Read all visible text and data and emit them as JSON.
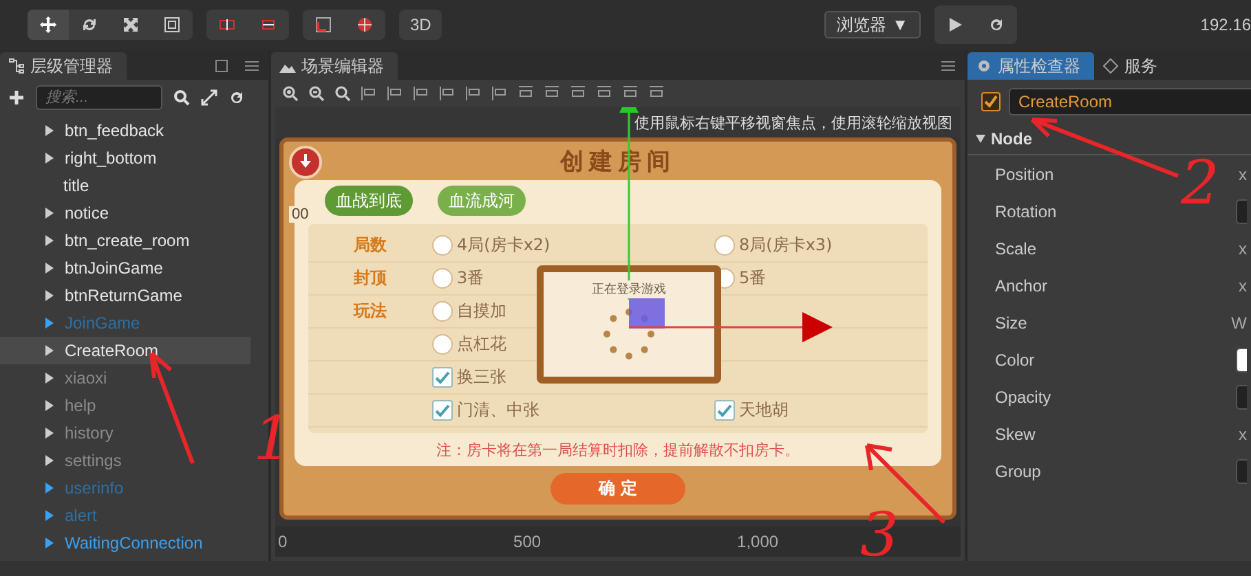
{
  "toolbar": {
    "transform_tools": [
      {
        "selected": true
      },
      {
        "selected": false
      },
      {
        "selected": false
      },
      {
        "selected": false
      }
    ],
    "mode_button": "3D",
    "platform": {
      "value": "浏览器",
      "arrow": "▼"
    },
    "address": "192.16"
  },
  "hierarchy": {
    "title": "层级管理器",
    "search": {
      "placeholder": "搜索..."
    },
    "items": [
      {
        "label": "btn_feedback",
        "has_children": true,
        "prefab": false,
        "active": true,
        "selected": false
      },
      {
        "label": "right_bottom",
        "has_children": true,
        "prefab": false,
        "active": true,
        "selected": false
      },
      {
        "label": "title",
        "has_children": false,
        "prefab": false,
        "active": true,
        "selected": false
      },
      {
        "label": "notice",
        "has_children": true,
        "prefab": false,
        "active": true,
        "selected": false
      },
      {
        "label": "btn_create_room",
        "has_children": true,
        "prefab": false,
        "active": true,
        "selected": false
      },
      {
        "label": "btnJoinGame",
        "has_children": true,
        "prefab": false,
        "active": true,
        "selected": false
      },
      {
        "label": "btnReturnGame",
        "has_children": true,
        "prefab": false,
        "active": true,
        "selected": false
      },
      {
        "label": "JoinGame",
        "has_children": true,
        "prefab": true,
        "active": false,
        "selected": false
      },
      {
        "label": "CreateRoom",
        "has_children": true,
        "prefab": false,
        "active": true,
        "selected": true
      },
      {
        "label": "xiaoxi",
        "has_children": true,
        "prefab": false,
        "active": false,
        "selected": false
      },
      {
        "label": "help",
        "has_children": true,
        "prefab": false,
        "active": false,
        "selected": false
      },
      {
        "label": "history",
        "has_children": true,
        "prefab": false,
        "active": false,
        "selected": false
      },
      {
        "label": "settings",
        "has_children": true,
        "prefab": false,
        "active": false,
        "selected": false
      },
      {
        "label": "userinfo",
        "has_children": true,
        "prefab": true,
        "active": false,
        "selected": false
      },
      {
        "label": "alert",
        "has_children": true,
        "prefab": true,
        "active": false,
        "selected": false
      },
      {
        "label": "WaitingConnection",
        "has_children": true,
        "prefab": true,
        "active": true,
        "selected": false
      }
    ]
  },
  "scene": {
    "title": "场景编辑器",
    "hint": "使用鼠标右键平移视窗焦点，使用滚轮缩放视图",
    "left_ruler_label": "00",
    "bottom_ruler_labels": [
      "0",
      "500",
      "1,000"
    ],
    "dialog": {
      "title": "创建房间",
      "tabs": [
        {
          "label": "血战到底",
          "selected": true
        },
        {
          "label": "血流成河",
          "selected": false
        }
      ],
      "rows": [
        {
          "label": "局数",
          "options": [
            {
              "kind": "radio",
              "label": "4局(房卡x2)",
              "checked": false
            },
            {
              "kind": "radio",
              "label": "8局(房卡x3)",
              "checked": false
            }
          ]
        },
        {
          "label": "封顶",
          "options": [
            {
              "kind": "radio",
              "label": "3番",
              "checked": false
            },
            {
              "kind": "radio",
              "label": "5番",
              "checked": false
            }
          ]
        },
        {
          "label": "玩法",
          "options": [
            {
              "kind": "radio",
              "label": "自摸加",
              "checked": false
            }
          ]
        },
        {
          "label": "",
          "options": [
            {
              "kind": "radio",
              "label": "点杠花",
              "checked": false
            }
          ]
        },
        {
          "label": "",
          "options": [
            {
              "kind": "check",
              "label": "换三张",
              "checked": true
            }
          ]
        },
        {
          "label": "",
          "options": [
            {
              "kind": "check",
              "label": "门清、中张",
              "checked": true
            },
            {
              "kind": "check",
              "label": "天地胡",
              "checked": true
            }
          ]
        }
      ],
      "note": "注：房卡将在第一局结算时扣除，提前解散不扣房卡。",
      "confirm": "确 定"
    },
    "popup": {
      "text": "正在登录游戏"
    }
  },
  "inspector": {
    "tabs": [
      {
        "label": "属性检查器",
        "selected": true
      },
      {
        "label": "服务",
        "selected": false
      }
    ],
    "node_active": true,
    "node_name": "CreateRoom",
    "section": {
      "title": "Node",
      "expanded": true
    },
    "properties": [
      {
        "label": "Position",
        "kind": "text",
        "value": "x"
      },
      {
        "label": "Rotation",
        "kind": "field"
      },
      {
        "label": "Scale",
        "kind": "text",
        "value": "x"
      },
      {
        "label": "Anchor",
        "kind": "text",
        "value": "x"
      },
      {
        "label": "Size",
        "kind": "text",
        "value": "W"
      },
      {
        "label": "Color",
        "kind": "color"
      },
      {
        "label": "Opacity",
        "kind": "field"
      },
      {
        "label": "Skew",
        "kind": "text",
        "value": "x"
      },
      {
        "label": "Group",
        "kind": "field"
      }
    ]
  },
  "annotations": [
    {
      "label": "1"
    },
    {
      "label": "2"
    },
    {
      "label": "3"
    }
  ]
}
